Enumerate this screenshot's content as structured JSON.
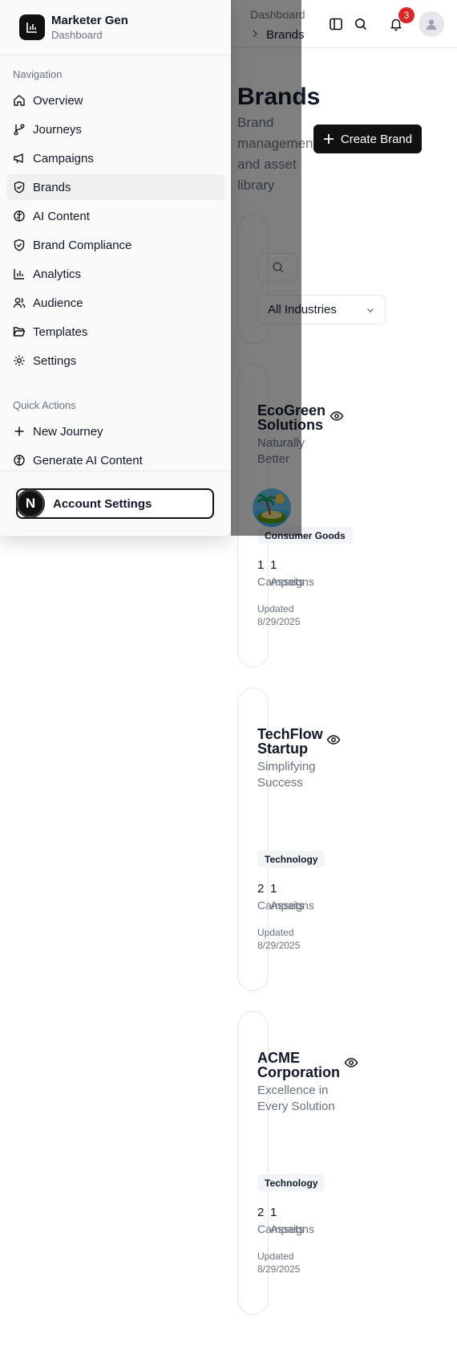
{
  "sidebar": {
    "app_name": "Marketer Gen",
    "app_subtitle": "Dashboard",
    "nav_heading": "Navigation",
    "nav_items": [
      {
        "label": "Overview",
        "icon": "home-icon"
      },
      {
        "label": "Journeys",
        "icon": "git-branch-icon"
      },
      {
        "label": "Campaigns",
        "icon": "megaphone-icon"
      },
      {
        "label": "Brands",
        "icon": "shield-check-icon",
        "active": true
      },
      {
        "label": "AI Content",
        "icon": "brain-icon"
      },
      {
        "label": "Brand Compliance",
        "icon": "shield-check-icon"
      },
      {
        "label": "Analytics",
        "icon": "bar-chart-icon"
      },
      {
        "label": "Audience",
        "icon": "users-icon"
      },
      {
        "label": "Templates",
        "icon": "folder-open-icon"
      },
      {
        "label": "Settings",
        "icon": "gear-icon"
      }
    ],
    "quick_heading": "Quick Actions",
    "quick_items": [
      {
        "label": "New Journey",
        "icon": "plus-icon"
      },
      {
        "label": "Generate AI Content",
        "icon": "brain-icon"
      }
    ],
    "account_label": "Account Settings",
    "account_initial": "N"
  },
  "header": {
    "breadcrumb_root": "Dashboard",
    "breadcrumb_current": "Brands",
    "notification_count": "3"
  },
  "page": {
    "title": "Brands",
    "subtitle": "Brand management and asset library",
    "create_label": "Create Brand"
  },
  "filters": {
    "industry_selected": "All Industries"
  },
  "brands": [
    {
      "name": "EcoGreen Solutions",
      "tagline": "Naturally Better",
      "industry": "Consumer Goods",
      "campaigns": "1",
      "campaigns_label": "Campaigns",
      "assets": "1",
      "assets_label": "Assets",
      "updated": "Updated 8/29/2025"
    },
    {
      "name": "TechFlow Startup",
      "tagline": "Simplifying Success",
      "industry": "Technology",
      "campaigns": "2",
      "campaigns_label": "Campaigns",
      "assets": "1",
      "assets_label": "Assets",
      "updated": "Updated 8/29/2025"
    },
    {
      "name": "ACME Corporation",
      "tagline": "Excellence in Every Solution",
      "industry": "Technology",
      "campaigns": "2",
      "campaigns_label": "Campaigns",
      "assets": "1",
      "assets_label": "Assets",
      "updated": "Updated 8/29/2025"
    }
  ],
  "colors": {
    "accent": "#111111",
    "badge_red": "#dc2626",
    "muted": "#6b7280"
  }
}
